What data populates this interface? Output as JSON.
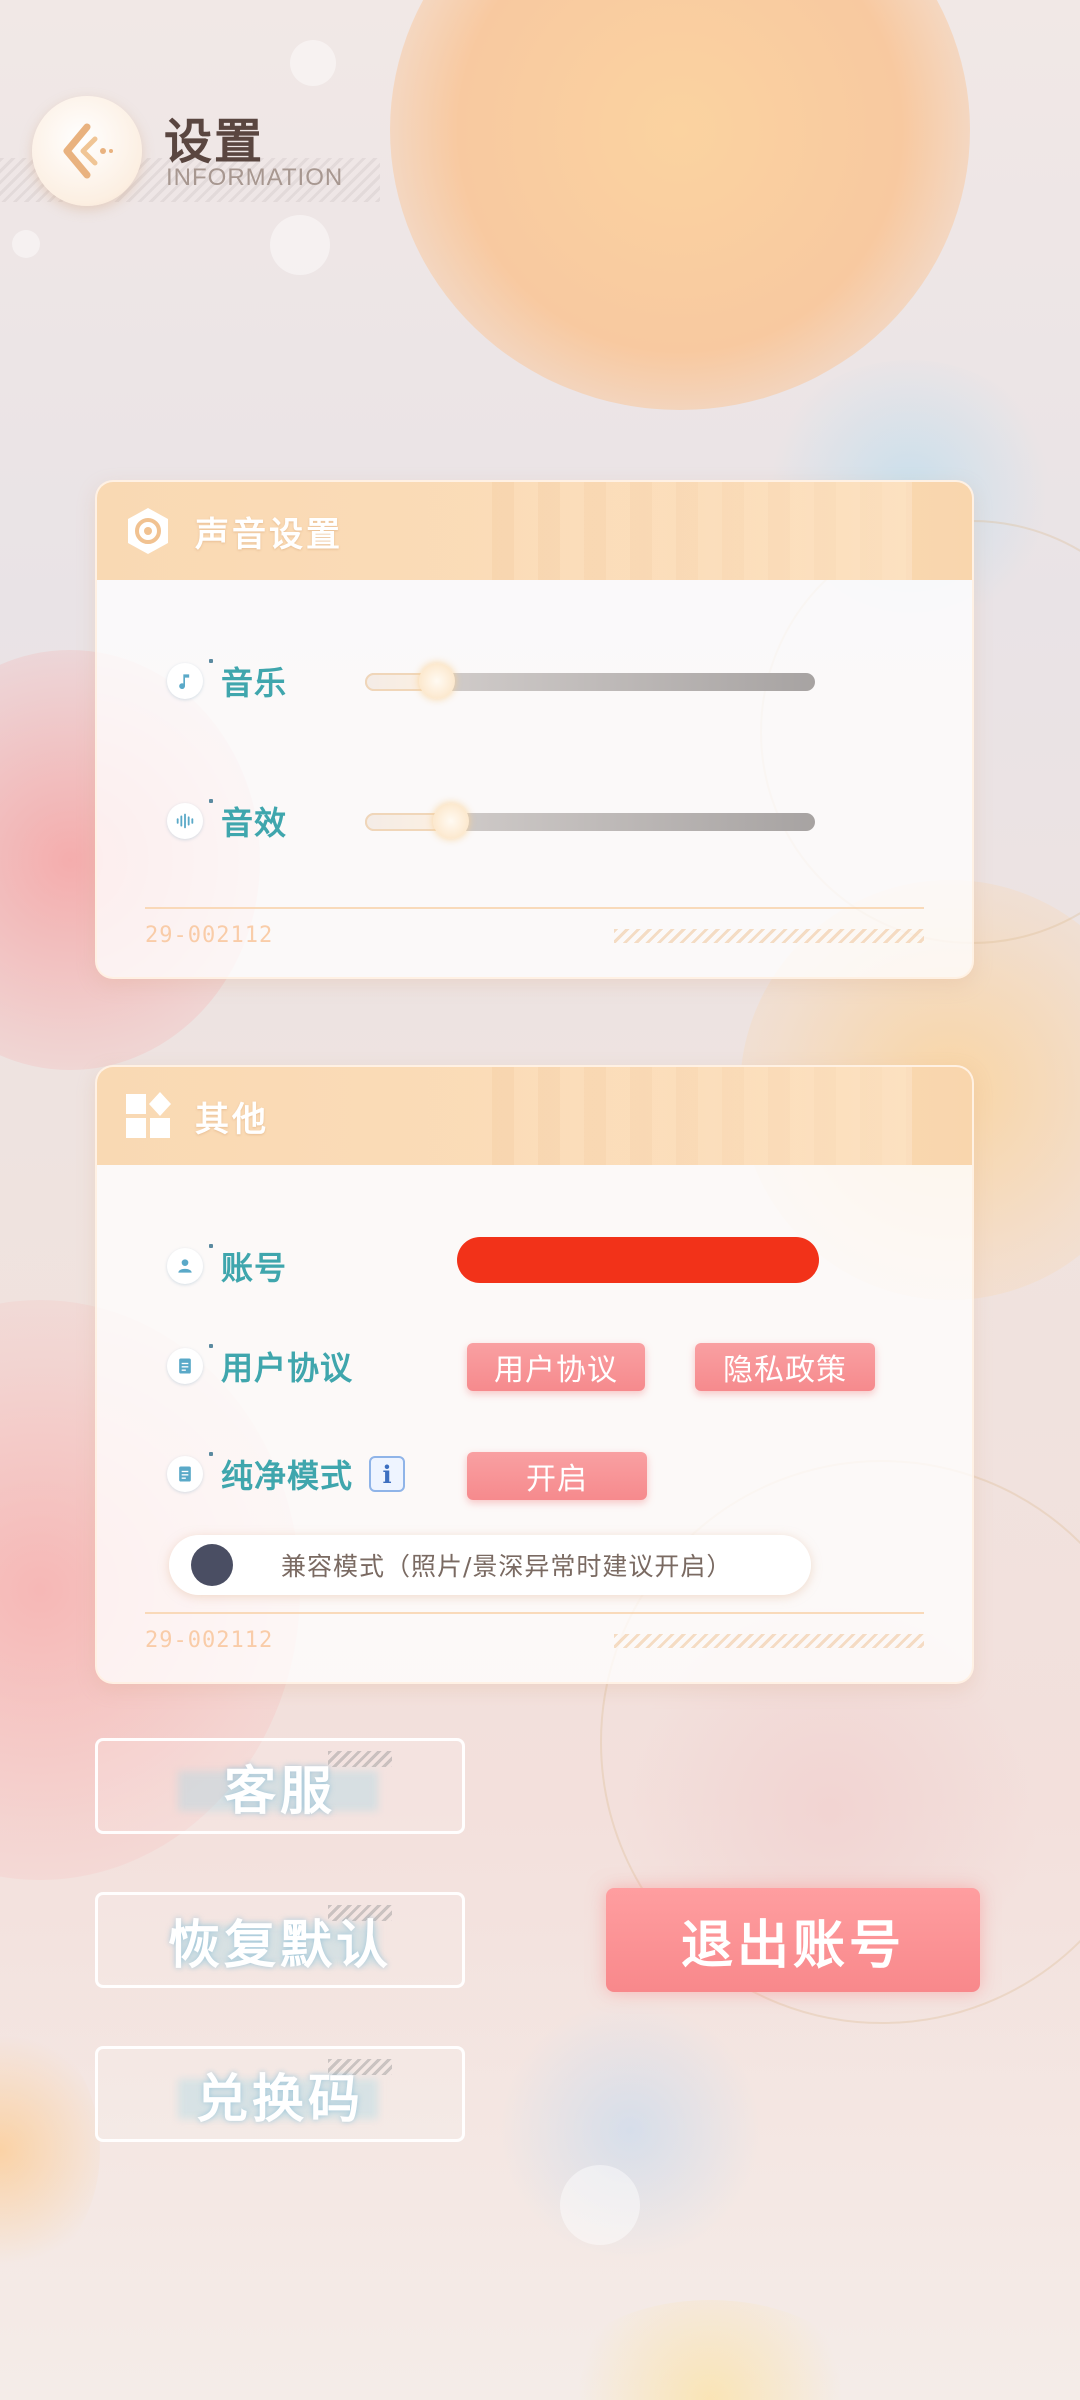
{
  "header": {
    "title": "设置",
    "subtitle": "INFORMATION",
    "back_icon": "back-arrow-icon"
  },
  "sound_panel": {
    "title": "声音设置",
    "icon": "hexagon-sound-icon",
    "music": {
      "label": "音乐",
      "icon": "music-note-icon",
      "level": 0.16
    },
    "effects": {
      "label": "音效",
      "icon": "waveform-icon",
      "level": 0.19
    },
    "footer_code": "29-002112"
  },
  "other_panel": {
    "title": "其他",
    "icon": "grid-shapes-icon",
    "account": {
      "label": "账号",
      "icon": "user-icon",
      "value_redacted": true
    },
    "agreement": {
      "label": "用户协议",
      "icon": "document-icon",
      "user_agreement_btn": "用户协议",
      "privacy_policy_btn": "隐私政策"
    },
    "pure_mode": {
      "label": "纯净模式",
      "icon": "document-icon",
      "info_icon": "info-icon",
      "info_glyph": "i",
      "button": "开启"
    },
    "compat_mode": {
      "label": "兼容模式（照片/景深异常时建议开启）",
      "enabled": false
    },
    "footer_code": "29-002112"
  },
  "buttons": {
    "customer_service": "客服",
    "restore_default": "恢复默认",
    "redeem_code": "兑换码",
    "logout": "退出账号"
  },
  "colors": {
    "accent_teal": "#3fa6ad",
    "accent_pink": "#f68a8d",
    "header_orange": "#f9d9b3",
    "redaction": "#f23219"
  }
}
